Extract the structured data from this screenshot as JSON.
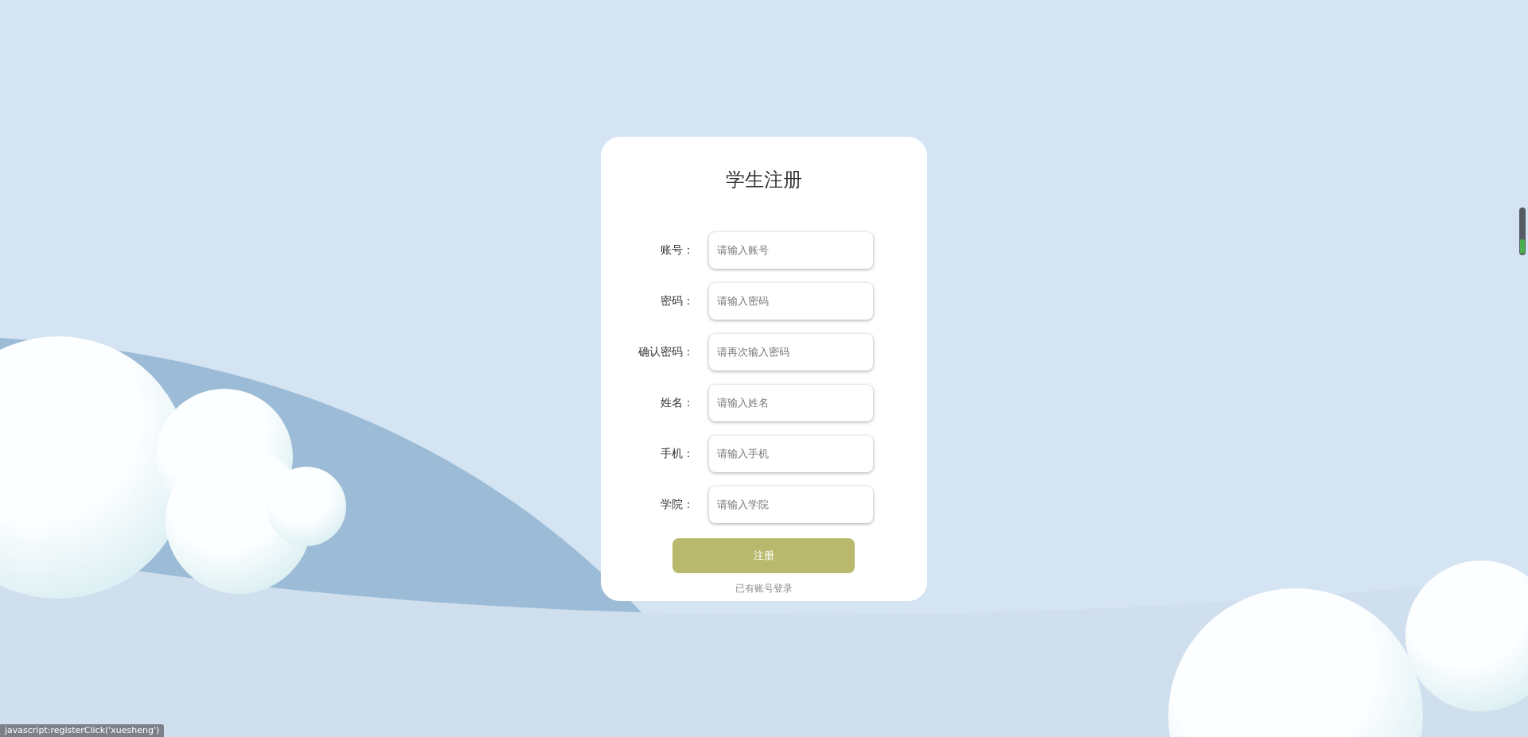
{
  "title": "学生注册",
  "fields": [
    {
      "label": "账号：",
      "placeholder": "请输入账号"
    },
    {
      "label": "密码：",
      "placeholder": "请输入密码"
    },
    {
      "label": "确认密码：",
      "placeholder": "请再次输入密码"
    },
    {
      "label": "姓名：",
      "placeholder": "请输入姓名"
    },
    {
      "label": "手机：",
      "placeholder": "请输入手机"
    },
    {
      "label": "学院：",
      "placeholder": "请输入学院"
    }
  ],
  "submit_button": "注册",
  "login_link": "已有账号登录",
  "status_text": "javascript:registerClick('xuesheng')"
}
